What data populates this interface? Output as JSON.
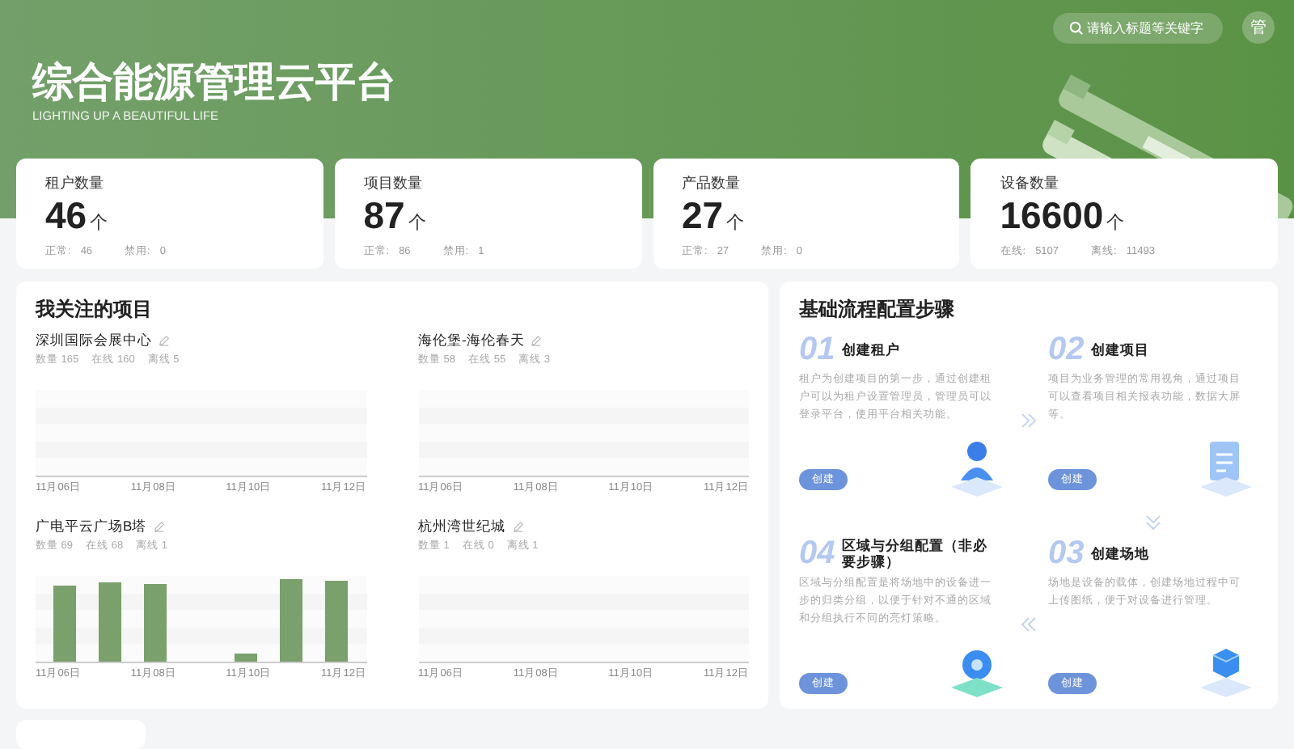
{
  "header": {
    "title": "综合能源管理云平台",
    "subtitle": "LIGHTING UP A BEAUTIFUL LIFE",
    "search": {
      "placeholder": "请输入标题等关键字"
    },
    "avatar": "管"
  },
  "stats": [
    {
      "label": "租户数量",
      "value": "46",
      "unit": "个",
      "sub": [
        {
          "label": "正常:",
          "value": "46"
        },
        {
          "label": "禁用:",
          "value": "0"
        }
      ]
    },
    {
      "label": "项目数量",
      "value": "87",
      "unit": "个",
      "sub": [
        {
          "label": "正常:",
          "value": "86"
        },
        {
          "label": "禁用:",
          "value": "1"
        }
      ]
    },
    {
      "label": "产品数量",
      "value": "27",
      "unit": "个",
      "sub": [
        {
          "label": "正常:",
          "value": "27"
        },
        {
          "label": "禁用:",
          "value": "0"
        }
      ]
    },
    {
      "label": "设备数量",
      "value": "16600",
      "unit": "个",
      "sub": [
        {
          "label": "在线:",
          "value": "5107"
        },
        {
          "label": "离线:",
          "value": "11493"
        }
      ]
    }
  ],
  "projects_panel": {
    "title": "我关注的项目",
    "projects": [
      {
        "name": "深圳国际会展中心",
        "stats": [
          "数量 165",
          "在线 160",
          "离线 5"
        ],
        "chart": {
          "kind": "empty",
          "x_labels": [
            "11月06日",
            "11月08日",
            "11月10日",
            "11月12日"
          ]
        }
      },
      {
        "name": "海伦堡-海伦春天",
        "stats": [
          "数量 58",
          "在线 55",
          "离线 3"
        ],
        "chart": {
          "kind": "empty",
          "x_labels": [
            "11月06日",
            "11月08日",
            "11月10日",
            "11月12日"
          ]
        }
      },
      {
        "name": "广电平云广场B塔",
        "stats": [
          "数量 69",
          "在线 68",
          "离线 1"
        ],
        "chart": {
          "kind": "bars",
          "x_labels": [
            "11月06日",
            "11月08日",
            "11月10日",
            "11月12日"
          ]
        }
      },
      {
        "name": "杭州湾世纪城",
        "stats": [
          "数量 1",
          "在线 0",
          "离线 1"
        ],
        "chart": {
          "kind": "empty",
          "x_labels": [
            "11月06日",
            "11月08日",
            "11月10日",
            "11月12日"
          ]
        }
      }
    ]
  },
  "steps_panel": {
    "title": "基础流程配置步骤",
    "steps": [
      {
        "number": "01",
        "title": "创建租户",
        "description": "租户为创建项目的第一步，通过创建租户可以为租户设置管理员，管理员可以登录平台，使用平台相关功能。",
        "button": "创建",
        "kind": "users"
      },
      {
        "number": "02",
        "title": "创建项目",
        "description": "项目为业务管理的常用视角，通过项目可以查看项目相关报表功能，数据大屏等。",
        "button": "创建",
        "kind": "document"
      },
      {
        "number": "04",
        "title": "区域与分组配置（非必要步骤）",
        "description": "区域与分组配置是将场地中的设备进一步的归类分组，以便于针对不通的区域和分组执行不同的亮灯策略。",
        "button": "创建",
        "kind": "gear"
      },
      {
        "number": "03",
        "title": "创建场地",
        "description": "场地是设备的载体，创建场地过程中可上传图纸，便于对设备进行管理。",
        "button": "创建",
        "kind": "cube"
      }
    ]
  }
}
